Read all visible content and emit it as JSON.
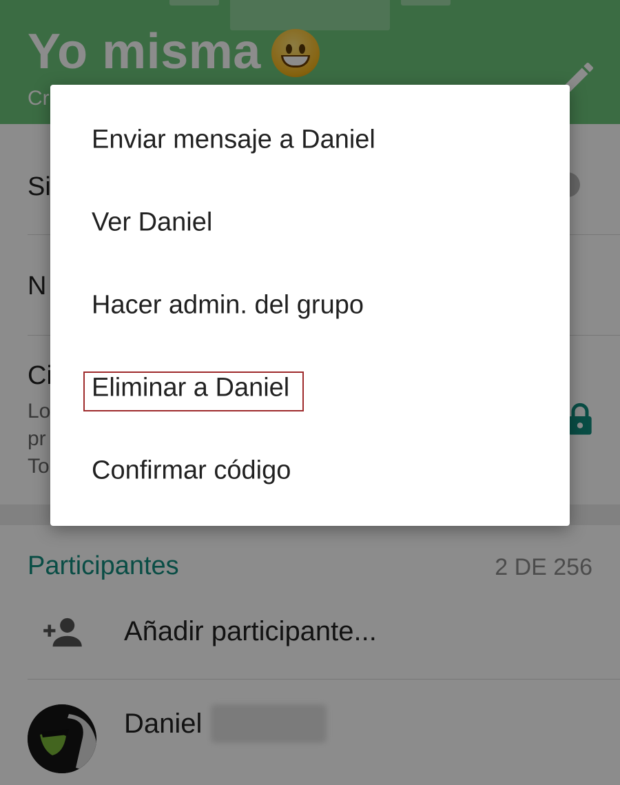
{
  "header": {
    "title": "Yo misma",
    "emoji": "grinning-face-emoji",
    "subtitle": "Cr",
    "edit_icon": "pencil-icon",
    "accent_color": "#6cc57a"
  },
  "settings_rows": [
    {
      "label": "Si"
    },
    {
      "label": "N"
    },
    {
      "label": "Ci",
      "sub_lines": [
        "Lo",
        "pr",
        "To"
      ]
    }
  ],
  "participants": {
    "title": "Participantes",
    "count": "2 DE 256",
    "add_label": "Añadir participante...",
    "members": [
      {
        "name": "Daniel"
      }
    ]
  },
  "dialog": {
    "items": [
      {
        "label": "Enviar mensaje a Daniel"
      },
      {
        "label": "Ver Daniel"
      },
      {
        "label": "Hacer admin. del grupo"
      },
      {
        "label": "Eliminar a Daniel",
        "highlighted": true
      },
      {
        "label": "Confirmar código"
      }
    ],
    "highlight_color": "#9e2a2b"
  }
}
